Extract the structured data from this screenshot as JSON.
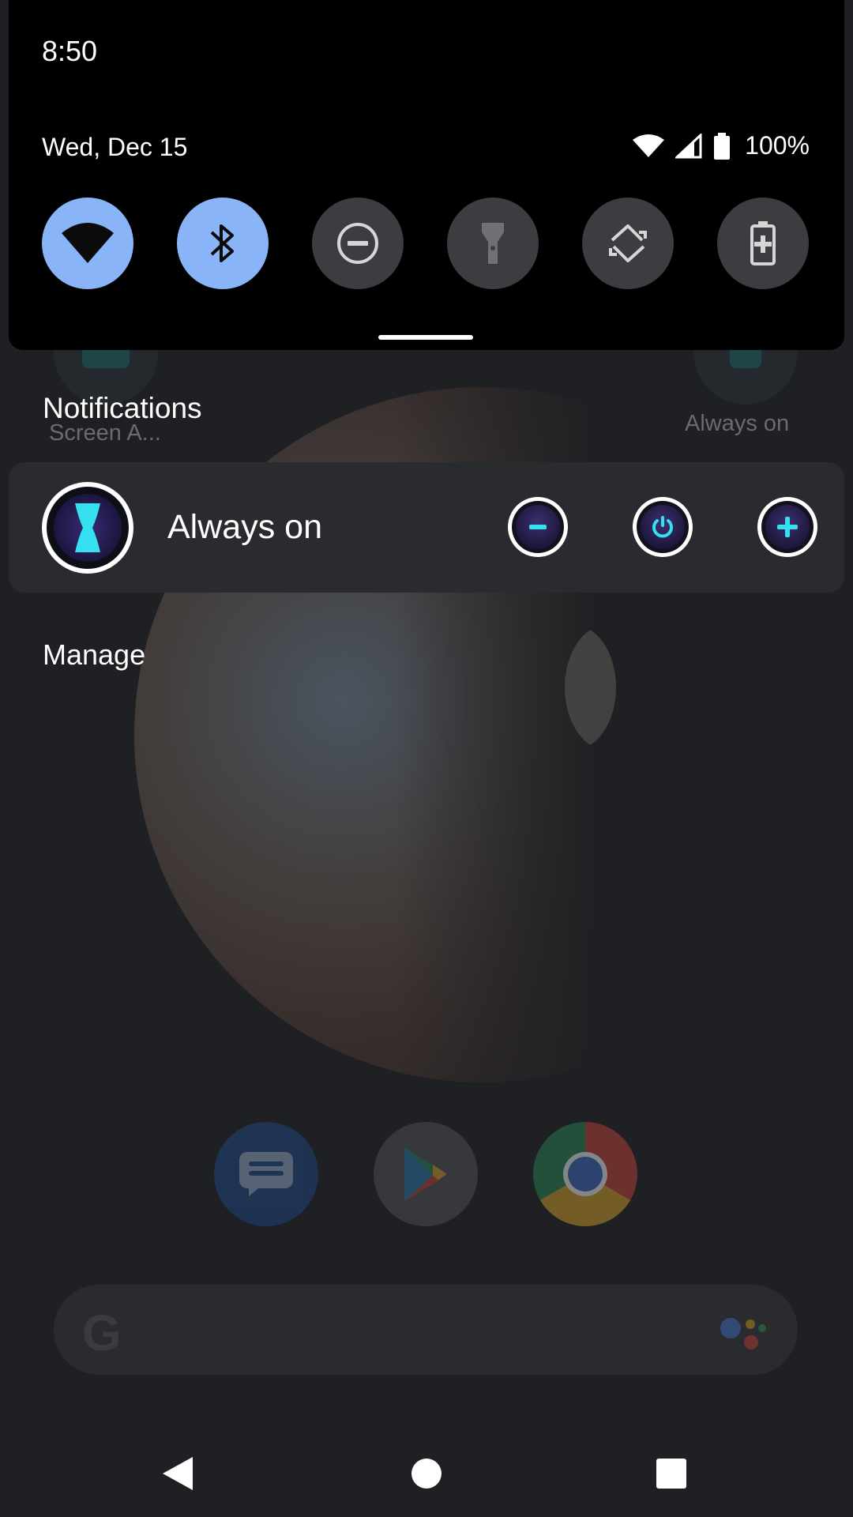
{
  "status_bar": {
    "time": "8:50",
    "date": "Wed, Dec 15",
    "battery_percent": "100%"
  },
  "quick_settings": {
    "tiles": [
      {
        "icon": "wifi-icon",
        "active": true
      },
      {
        "icon": "bluetooth-icon",
        "active": true
      },
      {
        "icon": "do-not-disturb-icon",
        "active": false
      },
      {
        "icon": "flashlight-icon",
        "active": false
      },
      {
        "icon": "auto-rotate-icon",
        "active": false
      },
      {
        "icon": "battery-saver-icon",
        "active": false
      }
    ],
    "active_color": "#8ab4f8",
    "inactive_color": "#3c3d40"
  },
  "notifications": {
    "header": "Notifications",
    "card": {
      "title": "Always on",
      "app_icon": "hourglass-app-icon",
      "actions": [
        {
          "icon": "minus-icon"
        },
        {
          "icon": "power-icon"
        },
        {
          "icon": "plus-icon"
        }
      ],
      "accent": "#35e0f0"
    },
    "manage_label": "Manage"
  },
  "homescreen": {
    "top_left_label": "Screen A...",
    "top_right_label": "Always on",
    "dock_apps": [
      "messages-icon",
      "play-store-icon",
      "chrome-icon"
    ],
    "search_logo": "G"
  },
  "navigation": {
    "buttons": [
      "back-icon",
      "home-icon",
      "recents-icon"
    ]
  }
}
